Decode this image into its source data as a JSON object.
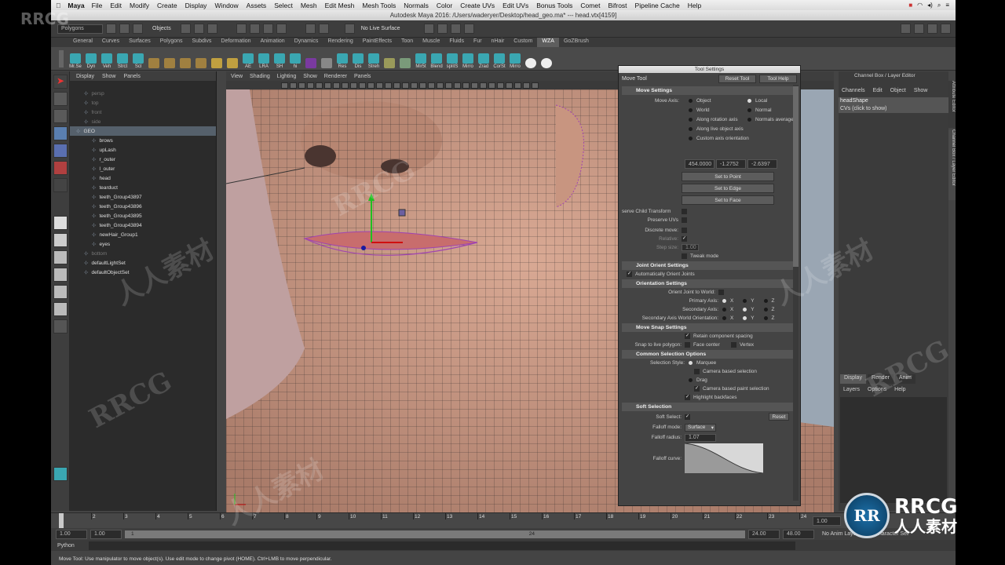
{
  "menubar": {
    "app_name": "Maya",
    "items": [
      "File",
      "Edit",
      "Modify",
      "Create",
      "Display",
      "Window",
      "Assets",
      "Select",
      "Mesh",
      "Edit Mesh",
      "Mesh Tools",
      "Normals",
      "Color",
      "Create UVs",
      "Edit UVs",
      "Bonus Tools",
      "Comet",
      "Bifrost",
      "Pipeline Cache",
      "Help"
    ]
  },
  "window_title": "Autodesk Maya 2016: /Users/waderyer/Desktop/head_geo.ma*   ---   head.vtx[4159]",
  "status_line": {
    "mode_menu": "Polygons",
    "objects_label": "Objects",
    "live_surface": "No Live Surface"
  },
  "shelf": {
    "tabs": [
      "General",
      "Curves",
      "Surfaces",
      "Polygons",
      "Subdivs",
      "Deformation",
      "Animation",
      "Dynamics",
      "Rendering",
      "PaintEffects",
      "Toon",
      "Muscle",
      "Fluids",
      "Fur",
      "nHair",
      "Custom",
      "WZA",
      "GoZBrush"
    ],
    "active_tab": "WZA",
    "buttons": [
      "Mr.Se",
      "Dyn",
      "Veh",
      "Strct",
      "Scl",
      "",
      "",
      "",
      "",
      "",
      "",
      "AE",
      "LRA",
      "SH",
      "hi",
      "",
      "",
      "Res",
      "Dis",
      "Streh",
      "",
      "",
      "Mir5t",
      "Blend",
      "splitS",
      "Mirro",
      "Zrad",
      "CorSt",
      "Mirro",
      "",
      ""
    ]
  },
  "outliner": {
    "menu": [
      "Display",
      "Show",
      "Panels"
    ],
    "items": [
      {
        "label": "persp",
        "dim": true,
        "indent": 1
      },
      {
        "label": "top",
        "dim": true,
        "indent": 1
      },
      {
        "label": "front",
        "dim": true,
        "indent": 1
      },
      {
        "label": "side",
        "dim": true,
        "indent": 1
      },
      {
        "label": "GEO",
        "selected": true,
        "indent": 0
      },
      {
        "label": "brows",
        "indent": 2
      },
      {
        "label": "upLash",
        "indent": 2
      },
      {
        "label": "r_outer",
        "indent": 2
      },
      {
        "label": "l_outer",
        "indent": 2
      },
      {
        "label": "head",
        "indent": 2
      },
      {
        "label": "tearduct",
        "indent": 2
      },
      {
        "label": "teeth_Group43897",
        "indent": 2
      },
      {
        "label": "teeth_Group43896",
        "indent": 2
      },
      {
        "label": "teeth_Group43895",
        "indent": 2
      },
      {
        "label": "teeth_Group43894",
        "indent": 2
      },
      {
        "label": "newHair_Group1",
        "indent": 2
      },
      {
        "label": "eyes",
        "indent": 2
      },
      {
        "label": "bottom",
        "dim": true,
        "indent": 1
      },
      {
        "label": "defaultLightSet",
        "indent": 1
      },
      {
        "label": "defaultObjectSet",
        "indent": 1
      }
    ]
  },
  "viewport": {
    "menu": [
      "View",
      "Shading",
      "Lighting",
      "Show",
      "Renderer",
      "Panels"
    ]
  },
  "tool_settings": {
    "title": "Tool Settings",
    "tool_name": "Move Tool",
    "reset_btn": "Reset Tool",
    "help_btn": "Tool Help",
    "move_settings": "Move Settings",
    "move_axis_label": "Move Axis:",
    "axes": [
      {
        "label": "Object",
        "on": false
      },
      {
        "label": "Local",
        "on": true
      },
      {
        "label": "World",
        "on": false
      },
      {
        "label": "Normal",
        "on": false
      },
      {
        "label": "Along rotation axis",
        "on": false
      },
      {
        "label": "Normals average",
        "on": false
      },
      {
        "label": "Along live object axis",
        "on": false
      },
      {
        "label": "Custom axis orientation",
        "on": false
      }
    ],
    "coords": [
      "454.0000",
      "-1.2752",
      "-2.6397"
    ],
    "set_point": "Set to Point",
    "set_edge": "Set to Edge",
    "set_face": "Set to Face",
    "preserve_child": "serve Child Transform",
    "preserve_uvs": "Preserve UVs",
    "discrete_move": "Discrete move:",
    "relative": "Relative:",
    "step_size": "Step size:",
    "step_value": "1.00",
    "tweak_mode": "Tweak mode",
    "joint_orient": "Joint Orient Settings",
    "auto_orient": "Automatically Orient Joints",
    "orientation_settings": "Orientation Settings",
    "orient_joint_world": "Orient Joint to World:",
    "primary_axis": "Primary Axis:",
    "secondary_axis": "Secondary Axis:",
    "secondary_world": "Secondary Axis World Orientation:",
    "xyz": [
      "X",
      "Y",
      "Z"
    ],
    "move_snap": "Move Snap Settings",
    "retain_spacing": "Retain component spacing",
    "snap_live": "Snap to live polygon:",
    "face_center": "Face center",
    "vertex": "Vertex",
    "common_selection": "Common Selection Options",
    "selection_style": "Selection Style:",
    "marquee": "Marquee",
    "camera_based": "Camera based selection",
    "drag": "Drag",
    "camera_paint": "Camera based paint selection",
    "highlight_backfaces": "Highlight backfaces",
    "soft_selection": "Soft Selection",
    "soft_select": "Soft Select:",
    "reset": "Reset",
    "falloff_mode": "Falloff mode:",
    "falloff_mode_value": "Surface",
    "falloff_radius": "Falloff radius:",
    "falloff_radius_value": "1.07",
    "falloff_curve": "Falloff curve:"
  },
  "channel_box": {
    "title": "Channel Box / Layer Editor",
    "menu": [
      "Channels",
      "Edit",
      "Object",
      "Show"
    ],
    "object": "headShape",
    "cvs": "CVs (click to show)",
    "side_tab_1": "Attribute Editor",
    "side_tab_2": "Channel Box / Layer Editor",
    "layer_tabs": [
      "Display",
      "Render",
      "Anim"
    ],
    "layer_menu": [
      "Layers",
      "Options",
      "Help"
    ]
  },
  "timeline": {
    "ticks": [
      "1",
      "2",
      "3",
      "4",
      "5",
      "6",
      "7",
      "8",
      "9",
      "10",
      "11",
      "12",
      "13",
      "14",
      "15",
      "16",
      "17",
      "18",
      "19",
      "20",
      "21",
      "22",
      "23",
      "24"
    ],
    "current": "1.00"
  },
  "range": {
    "start": "1.00",
    "start2": "1.00",
    "slider_start": "1",
    "slider_end": "24",
    "end": "24.00",
    "end2": "48.00",
    "anim_layer": "No Anim Layer",
    "char_set": "No Character Set"
  },
  "cmdline": {
    "label": "Python"
  },
  "helpline": "Move Tool: Use manipulator to move object(s). Use edit mode to change pivot (HOME). Ctrl+LMB to move perpendicular.",
  "watermarks": [
    "RRCG",
    "人人素材"
  ],
  "logo": {
    "top": "RRCG",
    "bottom": "人人素材"
  }
}
